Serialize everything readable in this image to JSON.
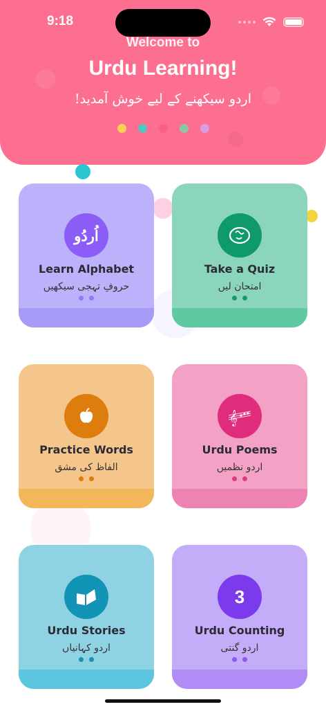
{
  "status_bar": {
    "time": "9:18"
  },
  "header": {
    "welcome": "Welcome to",
    "title": "Urdu Learning!",
    "subtitle": "اردو سیکھنے کے لیے خوش آمدید!",
    "dot_colors": [
      "#f7d154",
      "#55c6bd",
      "#fb5f86",
      "#8cc5a4",
      "#d99de0"
    ],
    "background": "#fd6f91"
  },
  "cards": [
    {
      "label": "Learn Alphabet",
      "urdu": "حروفِ تہجی سیکھیں",
      "icon_text": "اُردُو",
      "icon": "urdu-script-icon",
      "bg": "#bcb2fb",
      "band": "#a69bf6",
      "icon_bg": "#8b5cf6",
      "dot": "#8d7cf2"
    },
    {
      "label": "Take a Quiz",
      "urdu": "امتحان لیں",
      "icon_text": "",
      "icon": "brain-icon",
      "bg": "#8bd5bd",
      "band": "#5fc9a1",
      "icon_bg": "#0f9a6e",
      "dot": "#139a6b"
    },
    {
      "label": "Practice Words",
      "urdu": "الفاظ کی مشق",
      "icon_text": "",
      "icon": "apple-icon",
      "bg": "#f4c68c",
      "band": "#f2b65b",
      "icon_bg": "#dd7d0e",
      "dot": "#dd7d0e"
    },
    {
      "label": "Urdu Poems",
      "urdu": "اردو نظمیں",
      "icon_text": "",
      "icon": "music-notes-icon",
      "bg": "#f3a2c5",
      "band": "#ee82b2",
      "icon_bg": "#df2c7b",
      "dot": "#dd3a84"
    },
    {
      "label": "Urdu Stories",
      "urdu": "اردو کہانیاں",
      "icon_text": "",
      "icon": "open-book-icon",
      "bg": "#8fd2e3",
      "band": "#5bc6dd",
      "icon_bg": "#1194b6",
      "dot": "#1894b3"
    },
    {
      "label": "Urdu Counting",
      "urdu": "اردو گنتی",
      "icon_text": "3",
      "icon": "number-icon",
      "bg": "#c3adf9",
      "band": "#b18bf6",
      "icon_bg": "#7c3aed",
      "dot": "#8c58ee"
    }
  ]
}
